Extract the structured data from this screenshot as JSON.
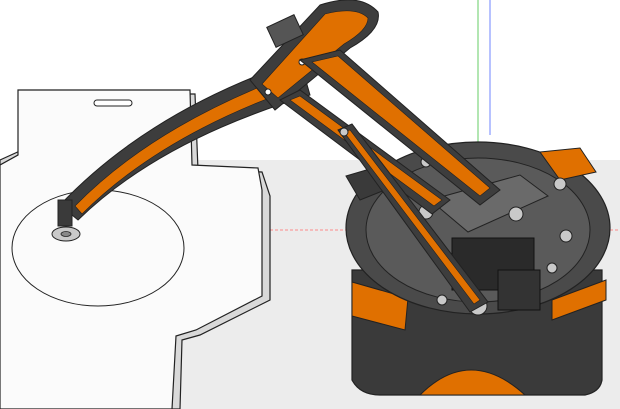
{
  "app": {
    "view": "3d-model-viewport"
  },
  "colors": {
    "background": "#ffffff",
    "ground": "#ececec",
    "plate": "#fbfbfb",
    "plate_shadow": "#d9d9d9",
    "outline": "#222222",
    "arm_dark": "#3d3d3d",
    "arm_accent": "#e07000",
    "base_dark": "#3a3a3a",
    "base_mid": "#5a5a5a",
    "metal": "#c9c9c9",
    "axis_red": "#ff6a6a",
    "axis_green": "#66cc66",
    "axis_blue": "#6f86ff"
  },
  "icons": {
    "mounting_hole": "slot-hole-icon",
    "pivot": "bolt-icon"
  }
}
